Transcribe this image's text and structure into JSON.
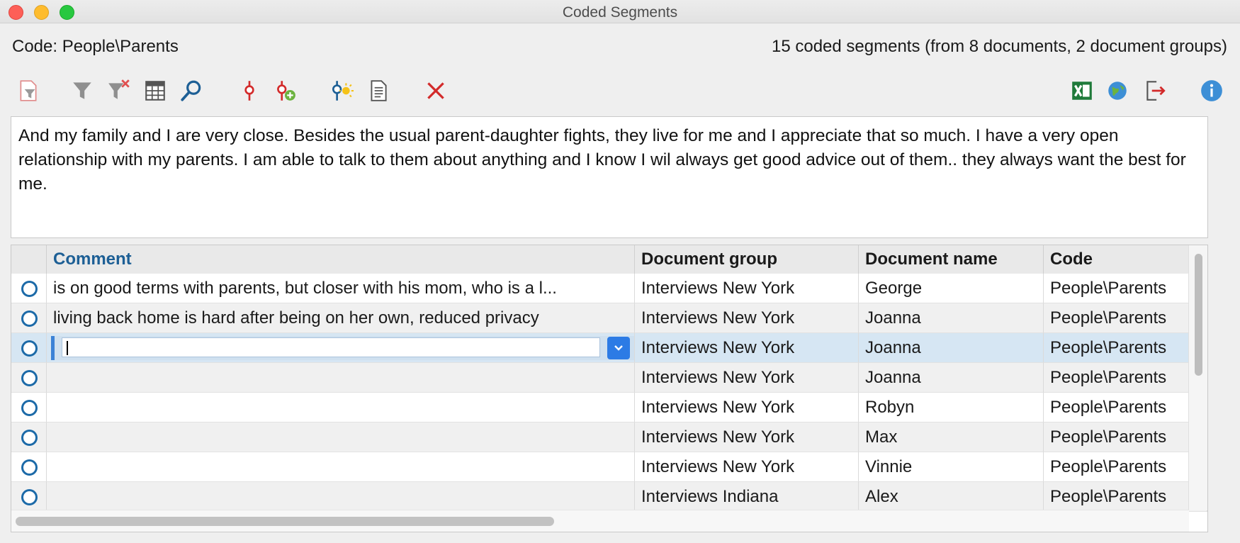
{
  "window": {
    "title": "Coded Segments"
  },
  "header": {
    "code_label": "Code: People\\Parents",
    "count_label": "15 coded segments (from 8 documents, 2 document groups)"
  },
  "toolbar": {
    "icons": [
      "filter-document-icon",
      "filter-icon",
      "clear-filter-icon",
      "columns-icon",
      "search-icon",
      "activate-code-icon",
      "add-code-icon",
      "code-insight-icon",
      "overview-icon",
      "delete-icon",
      "excel-export-icon",
      "web-export-icon",
      "export-icon",
      "info-icon"
    ],
    "colors": {
      "red": "#d32a2a",
      "blue": "#1d5f95",
      "green": "#1f7a3a"
    }
  },
  "preview": {
    "text": "And my family and I are very close. Besides the usual parent-daughter fights, they live for me and I appreciate that so much. I have a very open relationship with my parents. I am able to talk to them about anything and I know I wil always get good advice out of them.. they always want the best for me."
  },
  "table": {
    "columns": [
      "Comment",
      "Document group",
      "Document name",
      "Code"
    ],
    "rows": [
      {
        "comment": "is on good terms with parents, but closer with his mom, who is a l...",
        "group": "Interviews New York",
        "name": "George",
        "code": "People\\Parents"
      },
      {
        "comment": "living back home is hard after being on her own, reduced privacy",
        "group": "Interviews New York",
        "name": "Joanna",
        "code": "People\\Parents"
      },
      {
        "comment": "",
        "group": "Interviews New York",
        "name": "Joanna",
        "code": "People\\Parents",
        "editing": true
      },
      {
        "comment": "",
        "group": "Interviews New York",
        "name": "Joanna",
        "code": "People\\Parents"
      },
      {
        "comment": "",
        "group": "Interviews New York",
        "name": "Robyn",
        "code": "People\\Parents"
      },
      {
        "comment": "",
        "group": "Interviews New York",
        "name": "Max",
        "code": "People\\Parents"
      },
      {
        "comment": "",
        "group": "Interviews New York",
        "name": "Vinnie",
        "code": "People\\Parents"
      },
      {
        "comment": "",
        "group": "Interviews Indiana",
        "name": "Alex",
        "code": "People\\Parents"
      }
    ]
  }
}
